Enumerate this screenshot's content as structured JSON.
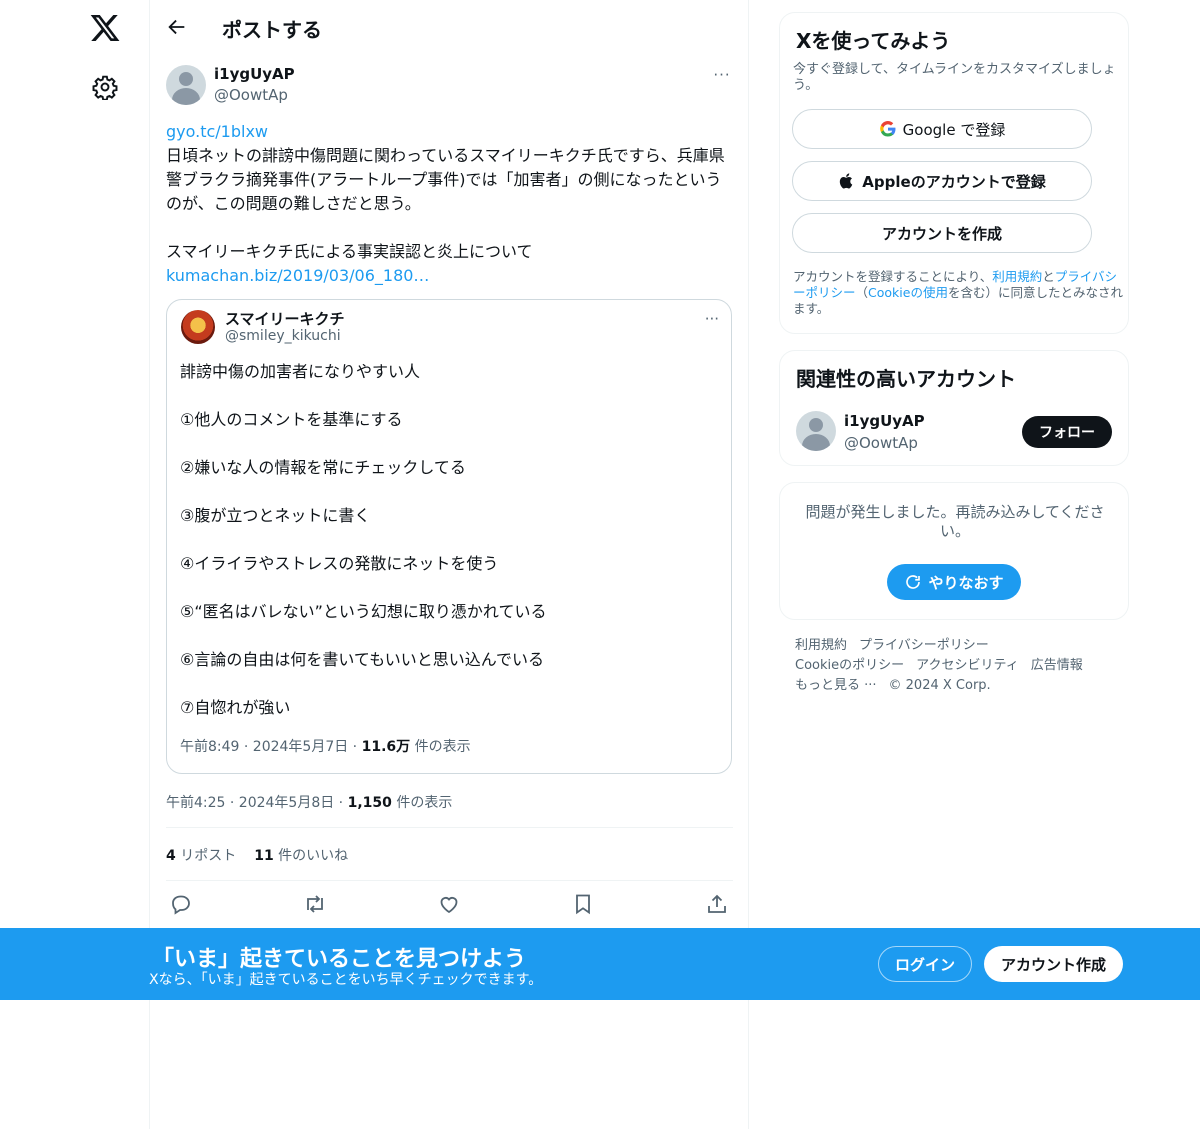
{
  "nav": {
    "logo_icon": "x-logo-icon",
    "settings_icon": "gear-icon"
  },
  "header": {
    "back_icon": "back-arrow-icon",
    "title": "ポストする"
  },
  "post": {
    "author_name": "i1ygUyAP",
    "author_handle": "@OowtAp",
    "more": "···",
    "link1": "gyo.tc/1blxw",
    "body": "日頃ネットの誹謗中傷問題に関わっているスマイリーキクチ氏ですら、兵庫県警ブラクラ摘発事件(アラートループ事件)では「加害者」の側になったというのが、この問題の難しさだと思う。\n\nスマイリーキクチ氏による事実誤認と炎上について",
    "link2": "kumachan.biz/2019/03/06_180…",
    "time": "午前4:25 · 2024年5月8日 · ",
    "views_count": "1,150",
    "views_label": " 件の表示",
    "reposts_count": "4",
    "reposts_label": " リポスト",
    "likes_count": "11",
    "likes_label": " 件のいいね"
  },
  "quote": {
    "name": "スマイリーキクチ",
    "handle": "@smiley_kikuchi",
    "more": "···",
    "body": "誹謗中傷の加害者になりやすい人\n\n①他人のコメントを基準にする\n\n②嫌いな人の情報を常にチェックしてる\n\n③腹が立つとネットに書く\n\n④イライラやストレスの発散にネットを使う\n\n⑤“匿名はバレない”という幻想に取り憑かれている\n\n⑥言論の自由は何を書いてもいいと思い込んでいる\n\n⑦自惚れが強い",
    "time": "午前8:49 · 2024年5月7日 · ",
    "views_count": "11.6万",
    "views_label": " 件の表示"
  },
  "actions": [
    "reply-icon",
    "repost-icon",
    "like-icon",
    "bookmark-icon",
    "share-icon"
  ],
  "signup": {
    "title": "Xを使ってみよう",
    "subtitle": "今すぐ登録して、タイムラインをカスタマイズしましょう。",
    "google_label": "Google で登録",
    "apple_label": "Appleのアカウントで登録",
    "create_label": "アカウントを作成",
    "legal_pre": "アカウントを登録することにより、",
    "legal_terms": "利用規約",
    "legal_and": "と",
    "legal_privacy": "プライバシーポリシー",
    "legal_mid": "（",
    "legal_cookie": "Cookieの使用",
    "legal_post": "を含む）に同意したとみなされます。"
  },
  "relevant": {
    "title": "関連性の高いアカウント",
    "name": "i1ygUyAP",
    "handle": "@OowtAp",
    "follow_label": "フォロー"
  },
  "error": {
    "message": "問題が発生しました。再読み込みしてください。",
    "retry_label": "やりなおす"
  },
  "footer": {
    "terms": "利用規約",
    "privacy": "プライバシーポリシー",
    "cookie": "Cookieのポリシー",
    "accessibility": "アクセシビリティ",
    "ads": "広告情報",
    "more": "もっと見る ···",
    "copyright": "© 2024 X Corp."
  },
  "banner": {
    "title": "「いま」起きていることを見つけよう",
    "subtitle": "Xなら、「いま」起きていることをいち早くチェックできます。",
    "login_label": "ログイン",
    "signup_label": "アカウント作成"
  },
  "colors": {
    "accent": "#1d9bf0",
    "text": "#0f1419",
    "secondary": "#536471"
  }
}
